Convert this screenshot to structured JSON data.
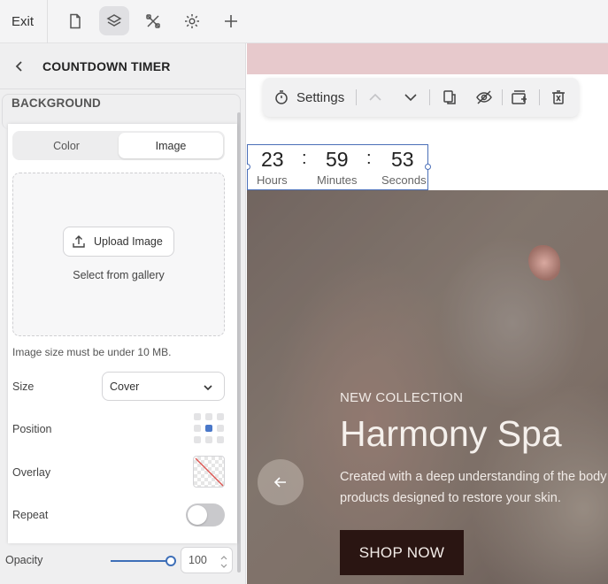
{
  "topbar": {
    "exit_label": "Exit"
  },
  "panel": {
    "title": "COUNTDOWN TIMER",
    "section_label": "BACKGROUND",
    "tabs": [
      {
        "label": "Color",
        "active": false
      },
      {
        "label": "Image",
        "active": true
      }
    ],
    "upload_label": "Upload Image",
    "gallery_label": "Select from gallery",
    "size_hint": "Image size must be under 10 MB.",
    "size": {
      "label": "Size",
      "value": "Cover"
    },
    "position": {
      "label": "Position",
      "selected_cell": 5
    },
    "overlay": {
      "label": "Overlay"
    },
    "repeat": {
      "label": "Repeat",
      "enabled": false
    },
    "opacity": {
      "label": "Opacity",
      "value": "100"
    }
  },
  "element_toolbar": {
    "settings_label": "Settings"
  },
  "countdown": {
    "hours": "23",
    "hours_label": "Hours",
    "minutes": "59",
    "minutes_label": "Minutes",
    "seconds": "53",
    "seconds_label": "Seconds",
    "separator": ":"
  },
  "hero": {
    "eyebrow": "NEW COLLECTION",
    "headline": "Harmony Spa",
    "subtext_line1": "Created with a deep understanding of the body",
    "subtext_line2": "products designed to restore your skin.",
    "cta_label": "SHOP NOW"
  },
  "colors": {
    "accent": "#4a78c9",
    "selection": "#4a6fb8",
    "cta_bg": "#2a1512",
    "brand_strip": "#e7c9cc"
  }
}
